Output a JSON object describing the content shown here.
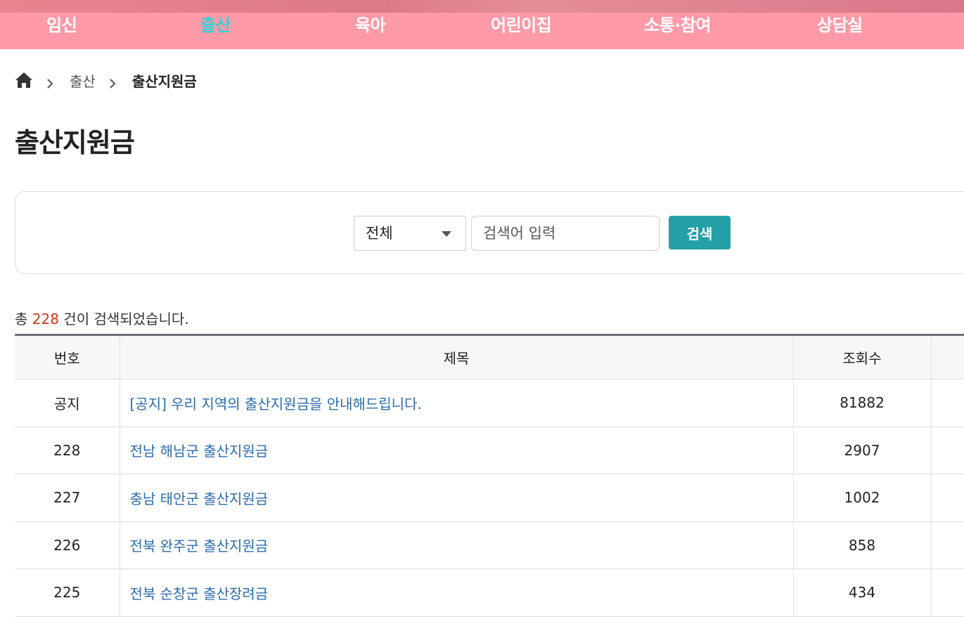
{
  "nav": {
    "items": [
      {
        "label": "임신",
        "active": false
      },
      {
        "label": "출산",
        "active": true
      },
      {
        "label": "육아",
        "active": false
      },
      {
        "label": "어린이집",
        "active": false
      },
      {
        "label": "소통·참여",
        "active": false
      },
      {
        "label": "상담실",
        "active": false
      }
    ],
    "active_color": "#33d1d6",
    "background_color": "#ff9aa9"
  },
  "breadcrumb": {
    "home_icon": "home-icon",
    "items": [
      "출산",
      "출산지원금"
    ]
  },
  "page_title": "출산지원금",
  "search": {
    "select_value": "전체",
    "input_placeholder": "검색어 입력",
    "input_value": "",
    "button_label": "검색",
    "button_color": "#23a0a8"
  },
  "result": {
    "prefix": "총 ",
    "count": "228",
    "suffix": " 건이 검색되었습니다."
  },
  "table": {
    "columns": [
      "번호",
      "제목",
      "조회수"
    ],
    "rows": [
      {
        "no": "공지",
        "title": "[공지] 우리 지역의 출산지원금을 안내해드립니다.",
        "views": "81882"
      },
      {
        "no": "228",
        "title": "전남 해남군 출산지원금",
        "views": "2907"
      },
      {
        "no": "227",
        "title": "충남 태안군 출산지원금",
        "views": "1002"
      },
      {
        "no": "226",
        "title": "전북 완주군 출산지원금",
        "views": "858"
      },
      {
        "no": "225",
        "title": "전북 순창군 출산장려금",
        "views": "434"
      }
    ]
  }
}
